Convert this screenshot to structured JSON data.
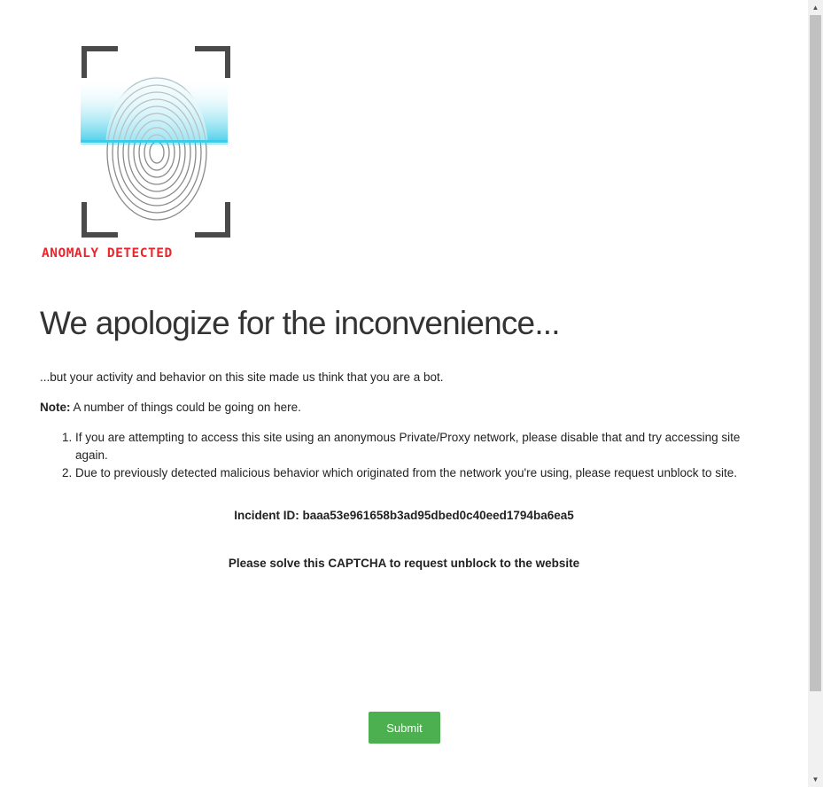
{
  "logo": {
    "caption": "ANOMALY DETECTED",
    "icon": "fingerprint-scan-icon",
    "caption_color": "#e8262c"
  },
  "heading": "We apologize for the inconvenience...",
  "intro": "...but your activity and behavior on this site made us think that you are a bot.",
  "note": {
    "label": "Note:",
    "text": " A number of things could be going on here."
  },
  "reasons": [
    "If you are attempting to access this site using an anonymous Private/Proxy network, please disable that and try accessing site again.",
    "Due to previously detected malicious behavior which originated from the network you're using, please request unblock to site."
  ],
  "incident": "Incident ID: baaa53e961658b3ad95dbed0c40eed1794ba6ea5",
  "captcha_prompt": "Please solve this CAPTCHA to request unblock to the website",
  "submit_label": "Submit",
  "colors": {
    "submit_bg": "#4caf50",
    "scan_line": "#3ccbe8"
  }
}
